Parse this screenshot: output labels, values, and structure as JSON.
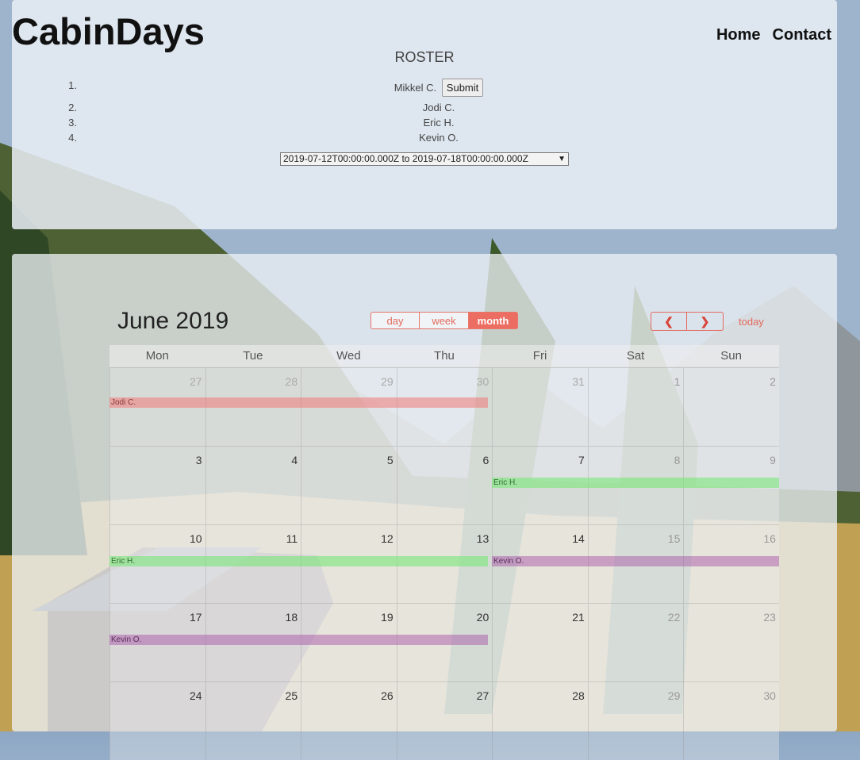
{
  "app": {
    "logo": "CabinDays"
  },
  "nav": {
    "home": "Home",
    "contact": "Contact"
  },
  "roster": {
    "title": "ROSTER",
    "members": [
      {
        "num": "1.",
        "name": "Mikkel C."
      },
      {
        "num": "2.",
        "name": "Jodi C."
      },
      {
        "num": "3.",
        "name": "Eric H."
      },
      {
        "num": "4.",
        "name": "Kevin O."
      }
    ],
    "submit_label": "Submit",
    "range_value": "2019-07-12T00:00:00.000Z to 2019-07-18T00:00:00.000Z"
  },
  "calendar": {
    "title": "June 2019",
    "views": {
      "day": "day",
      "week": "week",
      "month": "month"
    },
    "prev": "❮",
    "next": "❯",
    "today": "today",
    "weekdays": [
      "Mon",
      "Tue",
      "Wed",
      "Thu",
      "Fri",
      "Sat",
      "Sun"
    ],
    "weeks": [
      [
        "27",
        "28",
        "29",
        "30",
        "31",
        "1",
        "2"
      ],
      [
        "3",
        "4",
        "5",
        "6",
        "7",
        "8",
        "9"
      ],
      [
        "10",
        "11",
        "12",
        "13",
        "14",
        "15",
        "16"
      ],
      [
        "17",
        "18",
        "19",
        "20",
        "21",
        "22",
        "23"
      ],
      [
        "24",
        "25",
        "26",
        "27",
        "28",
        "29",
        "30"
      ]
    ],
    "events": [
      {
        "label": "Jodi C.",
        "color": "red"
      },
      {
        "label": "Eric H.",
        "color": "green"
      },
      {
        "label": "Eric H.",
        "color": "green"
      },
      {
        "label": "Kevin O.",
        "color": "purple"
      },
      {
        "label": "Kevin O.",
        "color": "purple"
      }
    ]
  }
}
